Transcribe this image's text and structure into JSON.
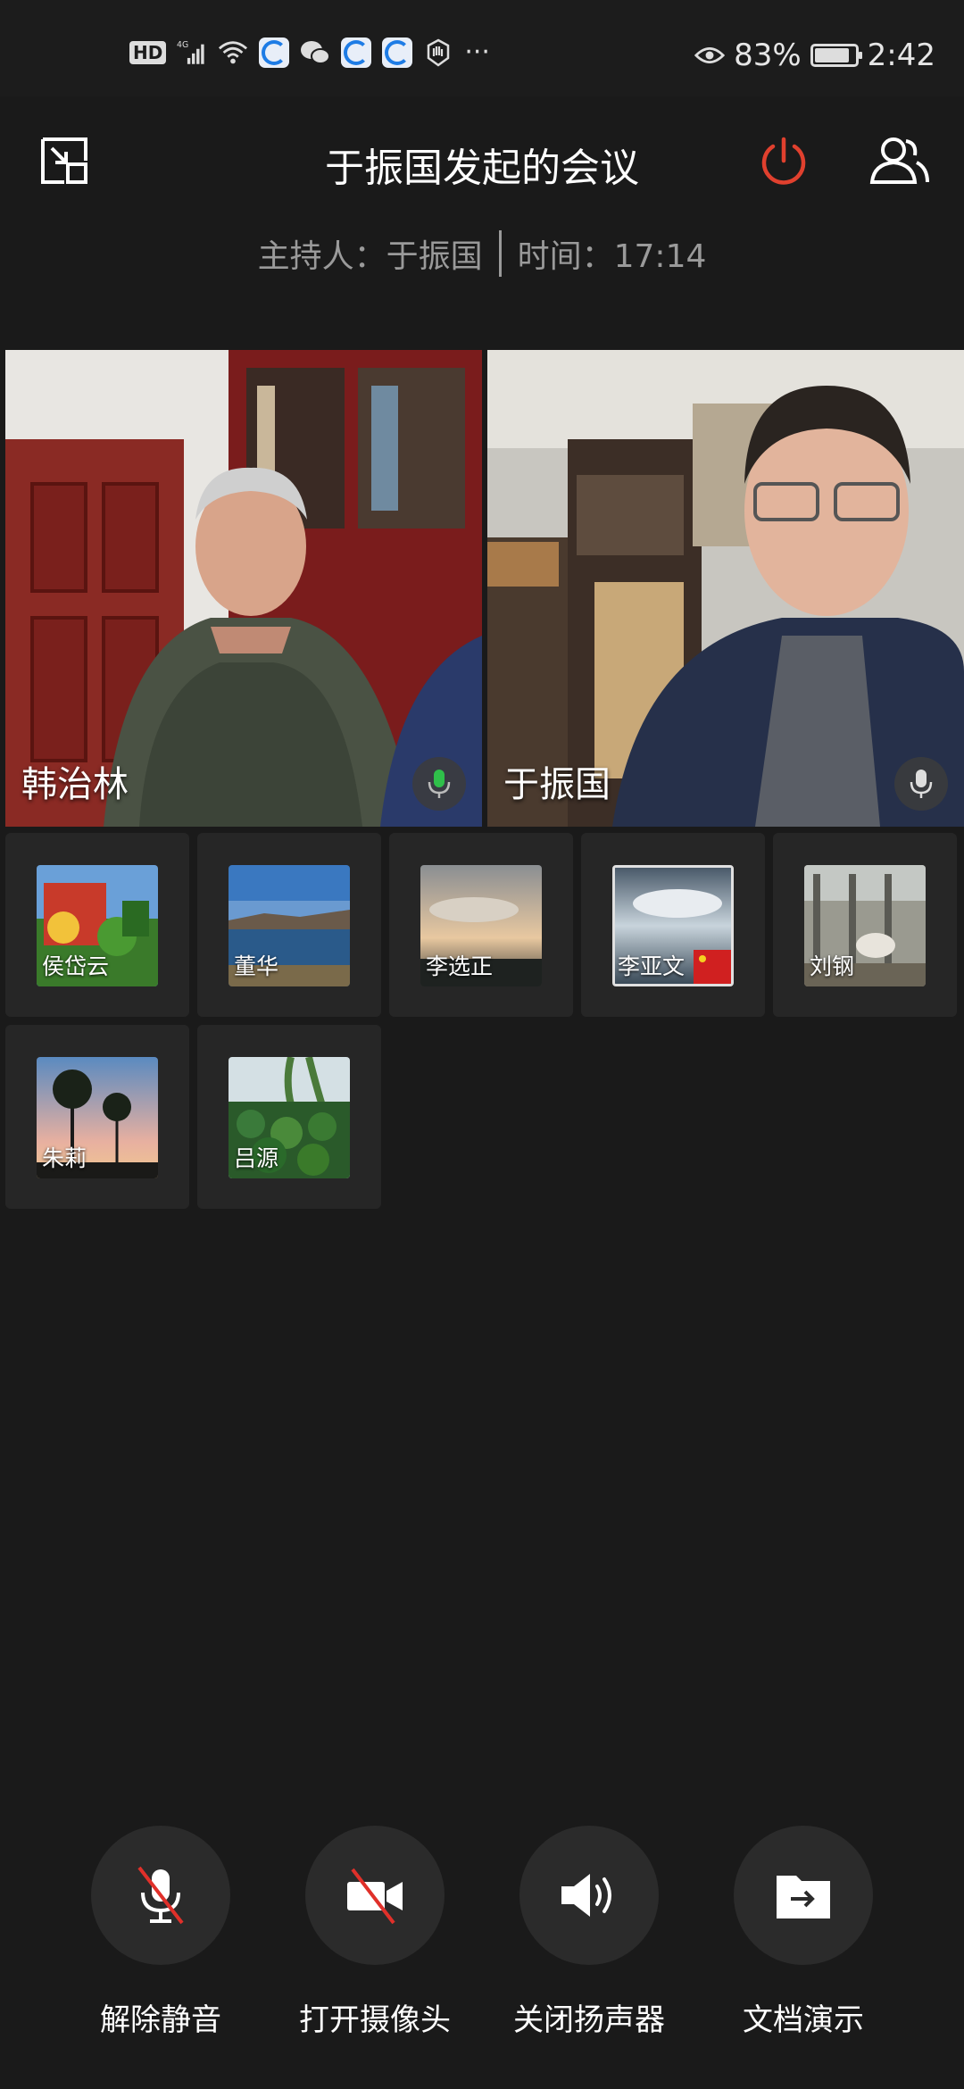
{
  "status_bar": {
    "hd": "HD",
    "network": "4G",
    "more": "···",
    "battery": "83%",
    "time": "2:42"
  },
  "meeting": {
    "title": "于振国发起的会议",
    "host": "主持人：于振国",
    "time": "时间：17:14"
  },
  "videos": [
    {
      "name": "韩治林",
      "mic": "active"
    },
    {
      "name": "于振国",
      "mic": "idle"
    }
  ],
  "participants": [
    {
      "name": "侯岱云"
    },
    {
      "name": "董华"
    },
    {
      "name": "李选正"
    },
    {
      "name": "李亚文"
    },
    {
      "name": "刘钢"
    },
    {
      "name": "朱莉"
    },
    {
      "name": "吕源"
    }
  ],
  "controls": [
    {
      "label": "解除静音",
      "icon": "mic-muted-icon"
    },
    {
      "label": "打开摄像头",
      "icon": "camera-off-icon"
    },
    {
      "label": "关闭扬声器",
      "icon": "speaker-icon"
    },
    {
      "label": "文档演示",
      "icon": "share-document-icon"
    }
  ],
  "colors": {
    "background": "#1a1a1a",
    "end_meeting": "#e0402e",
    "tile": "#262626",
    "control_circle": "#2b2b2b"
  }
}
